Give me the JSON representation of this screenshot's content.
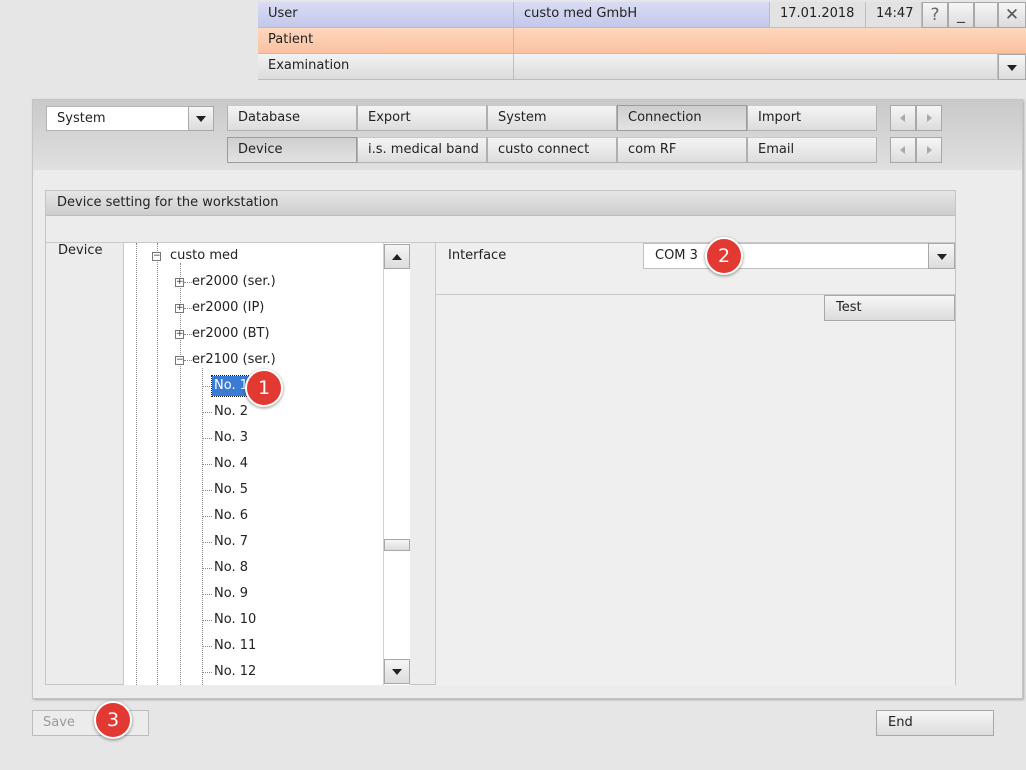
{
  "header": {
    "user_label": "User",
    "user_value": "custo med GmbH",
    "date": "17.01.2018",
    "time": "14:47",
    "help_glyph": "?",
    "minimize_glyph": "_",
    "close_glyph": "✕",
    "patient_label": "Patient",
    "patient_value": "",
    "examination_label": "Examination",
    "examination_value": ""
  },
  "nav": {
    "category_select": "System",
    "tabs_row1": [
      "Database",
      "Export",
      "System",
      "Connection",
      "Import"
    ],
    "tabs_row2": [
      "Device",
      "i.s. medical band",
      "custo connect",
      "com RF",
      "Email"
    ],
    "active_row1": "Connection",
    "active_row2": "Device"
  },
  "panel": {
    "title": "Device setting for the workstation",
    "device_label": "Device",
    "interface_label": "Interface",
    "interface_value": "COM 3",
    "test_button": "Test"
  },
  "tree": {
    "root": "custo med",
    "groups": [
      "er2000 (ser.)",
      "er2000 (IP)",
      "er2000 (BT)",
      "er2100 (ser.)"
    ],
    "items": [
      "No. 1",
      "No. 2",
      "No. 3",
      "No. 4",
      "No. 5",
      "No. 6",
      "No. 7",
      "No. 8",
      "No. 9",
      "No. 10",
      "No. 11",
      "No. 12"
    ],
    "selected": "No. 1"
  },
  "footer": {
    "save_button": "Save",
    "end_button": "End"
  },
  "callouts": [
    "1",
    "2",
    "3"
  ],
  "colors": {
    "user_row": "#c9cdeb",
    "patient_row": "#fbc9a8",
    "selection": "#3a7bd5",
    "callout": "#e23a32"
  }
}
